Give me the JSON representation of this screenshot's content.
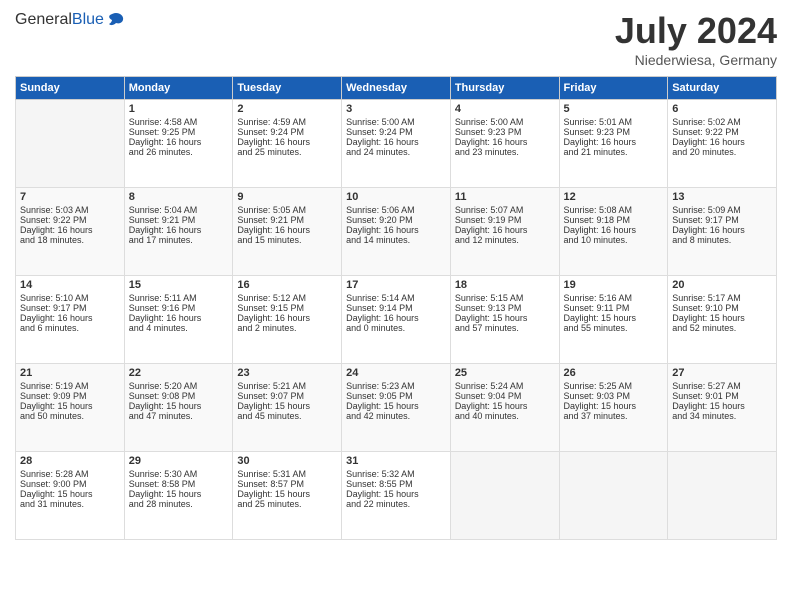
{
  "header": {
    "logo_general": "General",
    "logo_blue": "Blue",
    "month": "July 2024",
    "location": "Niederwiesa, Germany"
  },
  "days_of_week": [
    "Sunday",
    "Monday",
    "Tuesday",
    "Wednesday",
    "Thursday",
    "Friday",
    "Saturday"
  ],
  "weeks": [
    [
      {
        "day": "",
        "data": ""
      },
      {
        "day": "1",
        "data": "Sunrise: 4:58 AM\nSunset: 9:25 PM\nDaylight: 16 hours\nand 26 minutes."
      },
      {
        "day": "2",
        "data": "Sunrise: 4:59 AM\nSunset: 9:24 PM\nDaylight: 16 hours\nand 25 minutes."
      },
      {
        "day": "3",
        "data": "Sunrise: 5:00 AM\nSunset: 9:24 PM\nDaylight: 16 hours\nand 24 minutes."
      },
      {
        "day": "4",
        "data": "Sunrise: 5:00 AM\nSunset: 9:23 PM\nDaylight: 16 hours\nand 23 minutes."
      },
      {
        "day": "5",
        "data": "Sunrise: 5:01 AM\nSunset: 9:23 PM\nDaylight: 16 hours\nand 21 minutes."
      },
      {
        "day": "6",
        "data": "Sunrise: 5:02 AM\nSunset: 9:22 PM\nDaylight: 16 hours\nand 20 minutes."
      }
    ],
    [
      {
        "day": "7",
        "data": "Sunrise: 5:03 AM\nSunset: 9:22 PM\nDaylight: 16 hours\nand 18 minutes."
      },
      {
        "day": "8",
        "data": "Sunrise: 5:04 AM\nSunset: 9:21 PM\nDaylight: 16 hours\nand 17 minutes."
      },
      {
        "day": "9",
        "data": "Sunrise: 5:05 AM\nSunset: 9:21 PM\nDaylight: 16 hours\nand 15 minutes."
      },
      {
        "day": "10",
        "data": "Sunrise: 5:06 AM\nSunset: 9:20 PM\nDaylight: 16 hours\nand 14 minutes."
      },
      {
        "day": "11",
        "data": "Sunrise: 5:07 AM\nSunset: 9:19 PM\nDaylight: 16 hours\nand 12 minutes."
      },
      {
        "day": "12",
        "data": "Sunrise: 5:08 AM\nSunset: 9:18 PM\nDaylight: 16 hours\nand 10 minutes."
      },
      {
        "day": "13",
        "data": "Sunrise: 5:09 AM\nSunset: 9:17 PM\nDaylight: 16 hours\nand 8 minutes."
      }
    ],
    [
      {
        "day": "14",
        "data": "Sunrise: 5:10 AM\nSunset: 9:17 PM\nDaylight: 16 hours\nand 6 minutes."
      },
      {
        "day": "15",
        "data": "Sunrise: 5:11 AM\nSunset: 9:16 PM\nDaylight: 16 hours\nand 4 minutes."
      },
      {
        "day": "16",
        "data": "Sunrise: 5:12 AM\nSunset: 9:15 PM\nDaylight: 16 hours\nand 2 minutes."
      },
      {
        "day": "17",
        "data": "Sunrise: 5:14 AM\nSunset: 9:14 PM\nDaylight: 16 hours\nand 0 minutes."
      },
      {
        "day": "18",
        "data": "Sunrise: 5:15 AM\nSunset: 9:13 PM\nDaylight: 15 hours\nand 57 minutes."
      },
      {
        "day": "19",
        "data": "Sunrise: 5:16 AM\nSunset: 9:11 PM\nDaylight: 15 hours\nand 55 minutes."
      },
      {
        "day": "20",
        "data": "Sunrise: 5:17 AM\nSunset: 9:10 PM\nDaylight: 15 hours\nand 52 minutes."
      }
    ],
    [
      {
        "day": "21",
        "data": "Sunrise: 5:19 AM\nSunset: 9:09 PM\nDaylight: 15 hours\nand 50 minutes."
      },
      {
        "day": "22",
        "data": "Sunrise: 5:20 AM\nSunset: 9:08 PM\nDaylight: 15 hours\nand 47 minutes."
      },
      {
        "day": "23",
        "data": "Sunrise: 5:21 AM\nSunset: 9:07 PM\nDaylight: 15 hours\nand 45 minutes."
      },
      {
        "day": "24",
        "data": "Sunrise: 5:23 AM\nSunset: 9:05 PM\nDaylight: 15 hours\nand 42 minutes."
      },
      {
        "day": "25",
        "data": "Sunrise: 5:24 AM\nSunset: 9:04 PM\nDaylight: 15 hours\nand 40 minutes."
      },
      {
        "day": "26",
        "data": "Sunrise: 5:25 AM\nSunset: 9:03 PM\nDaylight: 15 hours\nand 37 minutes."
      },
      {
        "day": "27",
        "data": "Sunrise: 5:27 AM\nSunset: 9:01 PM\nDaylight: 15 hours\nand 34 minutes."
      }
    ],
    [
      {
        "day": "28",
        "data": "Sunrise: 5:28 AM\nSunset: 9:00 PM\nDaylight: 15 hours\nand 31 minutes."
      },
      {
        "day": "29",
        "data": "Sunrise: 5:30 AM\nSunset: 8:58 PM\nDaylight: 15 hours\nand 28 minutes."
      },
      {
        "day": "30",
        "data": "Sunrise: 5:31 AM\nSunset: 8:57 PM\nDaylight: 15 hours\nand 25 minutes."
      },
      {
        "day": "31",
        "data": "Sunrise: 5:32 AM\nSunset: 8:55 PM\nDaylight: 15 hours\nand 22 minutes."
      },
      {
        "day": "",
        "data": ""
      },
      {
        "day": "",
        "data": ""
      },
      {
        "day": "",
        "data": ""
      }
    ]
  ]
}
